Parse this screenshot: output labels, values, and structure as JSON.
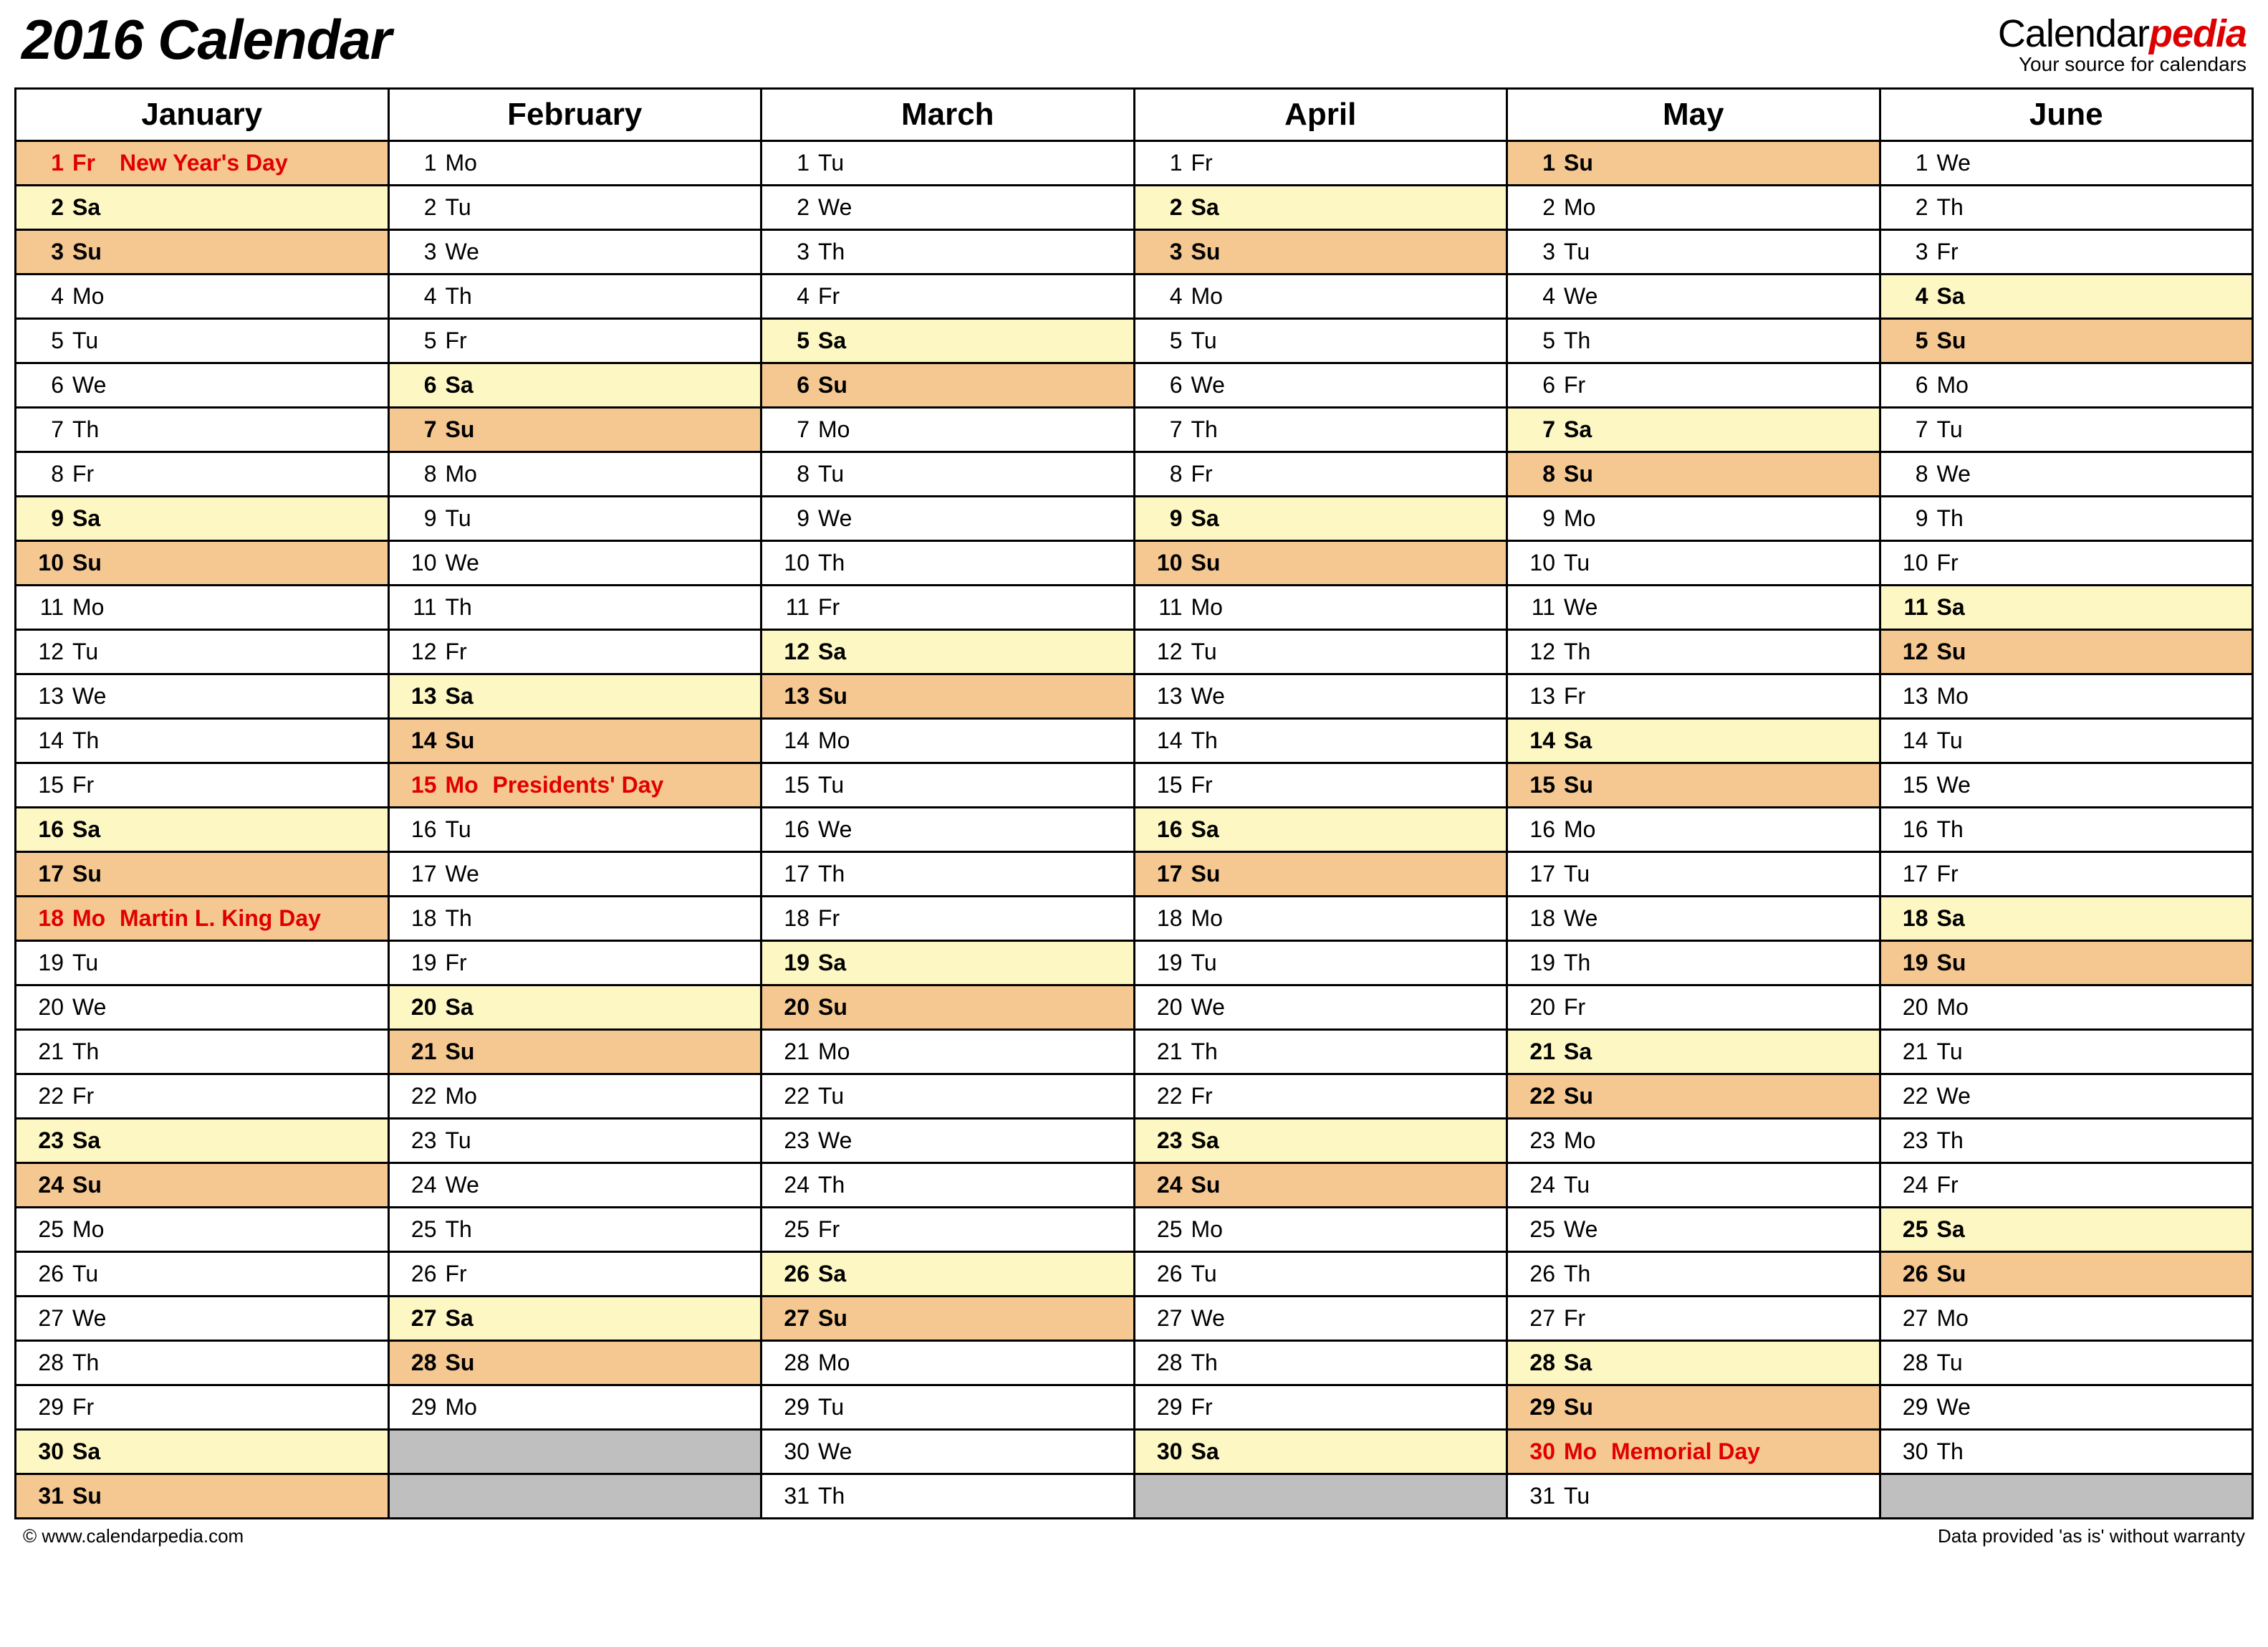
{
  "title": "2016 Calendar",
  "logo": {
    "part1": "Calendar",
    "part2": "pedia",
    "tagline": "Your source for calendars"
  },
  "footer_left": "© www.calendarpedia.com",
  "footer_right": "Data provided 'as is' without warranty",
  "months": [
    "January",
    "February",
    "March",
    "April",
    "May",
    "June"
  ],
  "dow_names": [
    "Su",
    "Mo",
    "Tu",
    "We",
    "Th",
    "Fr",
    "Sa"
  ],
  "start_dow": [
    5,
    1,
    2,
    5,
    0,
    3
  ],
  "days_in_month": [
    31,
    29,
    31,
    30,
    31,
    30
  ],
  "holidays": {
    "0": {
      "1": "New Year's Day",
      "18": "Martin L. King Day"
    },
    "1": {
      "15": "Presidents' Day"
    },
    "4": {
      "30": "Memorial Day"
    }
  },
  "rows": 31
}
